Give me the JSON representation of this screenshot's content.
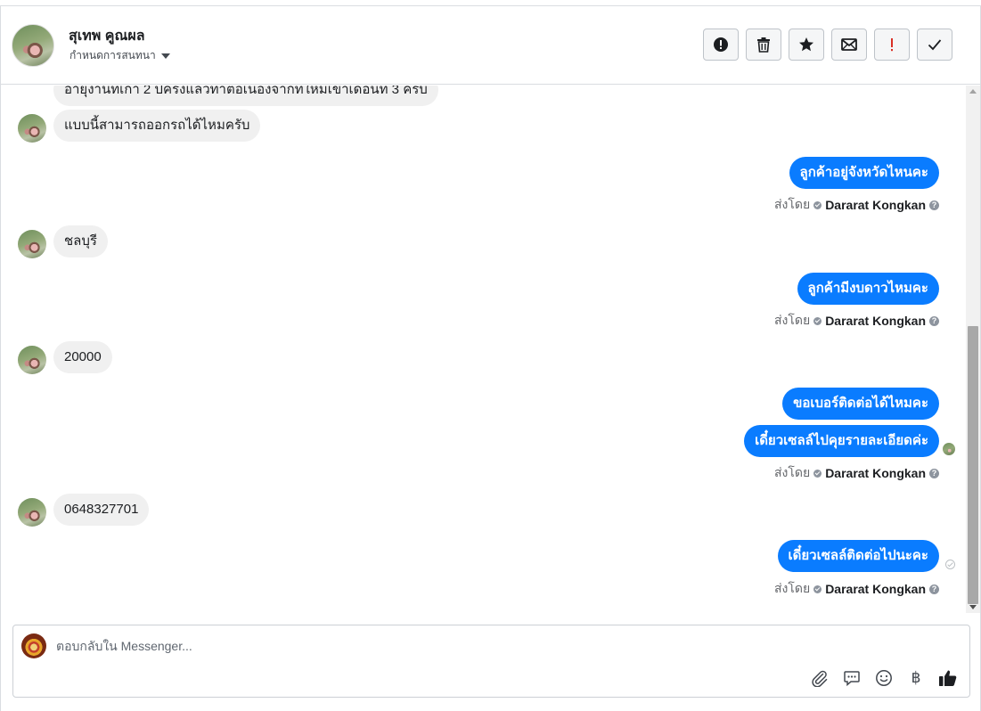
{
  "header": {
    "contact_name": "สุเทพ คูณผล",
    "conversation_label": "กำหนดการสนทนา",
    "actions": [
      {
        "name": "report-spam-button",
        "icon": "alert-circle-icon"
      },
      {
        "name": "delete-button",
        "icon": "trash-icon"
      },
      {
        "name": "star-button",
        "icon": "star-icon"
      },
      {
        "name": "mark-unread-button",
        "icon": "envelope-icon"
      },
      {
        "name": "follow-up-button",
        "icon": "exclamation-icon",
        "color": "#d93025"
      },
      {
        "name": "mark-done-button",
        "icon": "check-icon"
      }
    ]
  },
  "messages": {
    "in_0": "อายุงานที่เก่า 2 ปีครึ่งแล้วทำต่อเนื่องจากที่ใหม่เข้าเดือนที่ 3 ครับ",
    "in_1": "แบบนี้สามารถออกรถได้ไหมครับ",
    "out_0": "ลูกค้าอยู่จังหวัดไหนคะ",
    "in_2": "ชลบุรี",
    "out_1": "ลูกค้ามีงบดาวไหมคะ",
    "in_3": "20000",
    "out_2": "ขอเบอร์ติดต่อได้ไหมคะ",
    "out_3": "เดี๋ยวเซลล์ไปคุยรายละเอียดค่ะ",
    "in_4": "0648327701",
    "out_4": "เดี๋ยวเซลล์ติดต่อไปนะคะ",
    "sent_by_label": "ส่งโดย",
    "agent_name": "Dararat Kongkan",
    "help_glyph": "?"
  },
  "composer": {
    "placeholder": "ตอบกลับใน Messenger...",
    "tools": [
      "paperclip-icon",
      "saved-reply-icon",
      "emoji-icon",
      "baht-icon",
      "thumbs-up-icon"
    ],
    "baht_glyph": "฿"
  },
  "colors": {
    "outgoing_bubble": "#0a7cff",
    "incoming_bubble": "#f0f0f0",
    "accent_red": "#d93025"
  }
}
